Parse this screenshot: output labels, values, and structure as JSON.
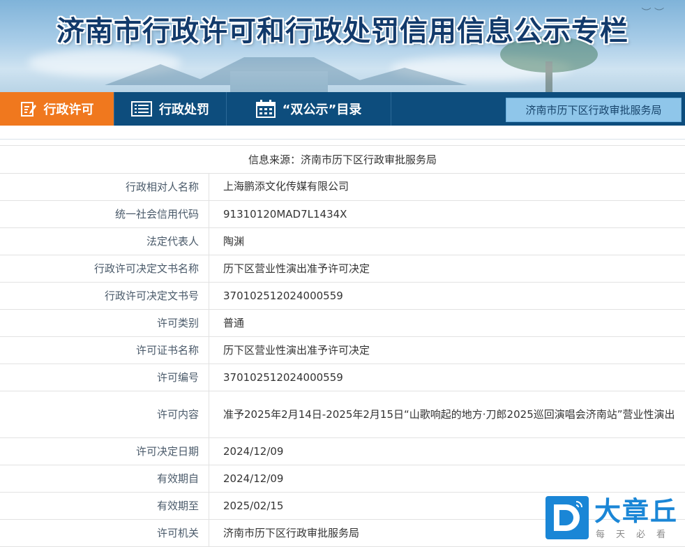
{
  "banner": {
    "title": "济南市行政许可和行政处罚信用信息公示专栏"
  },
  "nav": {
    "tabs": [
      {
        "label": "行政许可",
        "icon": "edit-document-icon",
        "active": true
      },
      {
        "label": "行政处罚",
        "icon": "list-icon",
        "active": false
      },
      {
        "label": "“双公示”目录",
        "icon": "calendar-icon",
        "active": false
      }
    ],
    "agency_button": "济南市历下区行政审批服务局"
  },
  "colors": {
    "nav_bg": "#0d4d7d",
    "active_tab": "#f0781e",
    "agency_button_bg": "#8fc6ea",
    "brand_blue": "#1a86d6"
  },
  "source": {
    "text": "信息来源：济南市历下区行政审批服务局"
  },
  "rows": [
    {
      "label": "行政相对人名称",
      "value": "上海鹏添文化传媒有限公司"
    },
    {
      "label": "统一社会信用代码",
      "value": "91310120MAD7L1434X"
    },
    {
      "label": "法定代表人",
      "value": "陶渊"
    },
    {
      "label": "行政许可决定文书名称",
      "value": "历下区营业性演出准予许可决定"
    },
    {
      "label": "行政许可决定文书号",
      "value": "370102512024000559"
    },
    {
      "label": "许可类别",
      "value": "普通"
    },
    {
      "label": "许可证书名称",
      "value": "历下区营业性演出准予许可决定"
    },
    {
      "label": "许可编号",
      "value": "370102512024000559"
    },
    {
      "label": "许可内容",
      "value": "准予2025年2月14日-2025年2月15日“山歌响起的地方·刀郎2025巡回演唱会济南站”营业性演出"
    },
    {
      "label": "许可决定日期",
      "value": "2024/12/09"
    },
    {
      "label": "有效期自",
      "value": "2024/12/09"
    },
    {
      "label": "有效期至",
      "value": "2025/02/15"
    },
    {
      "label": "许可机关",
      "value": "济南市历下区行政审批服务局"
    }
  ],
  "watermark": {
    "brand": "大章丘",
    "slogan": "每天必看",
    "logo_letter": "D"
  }
}
